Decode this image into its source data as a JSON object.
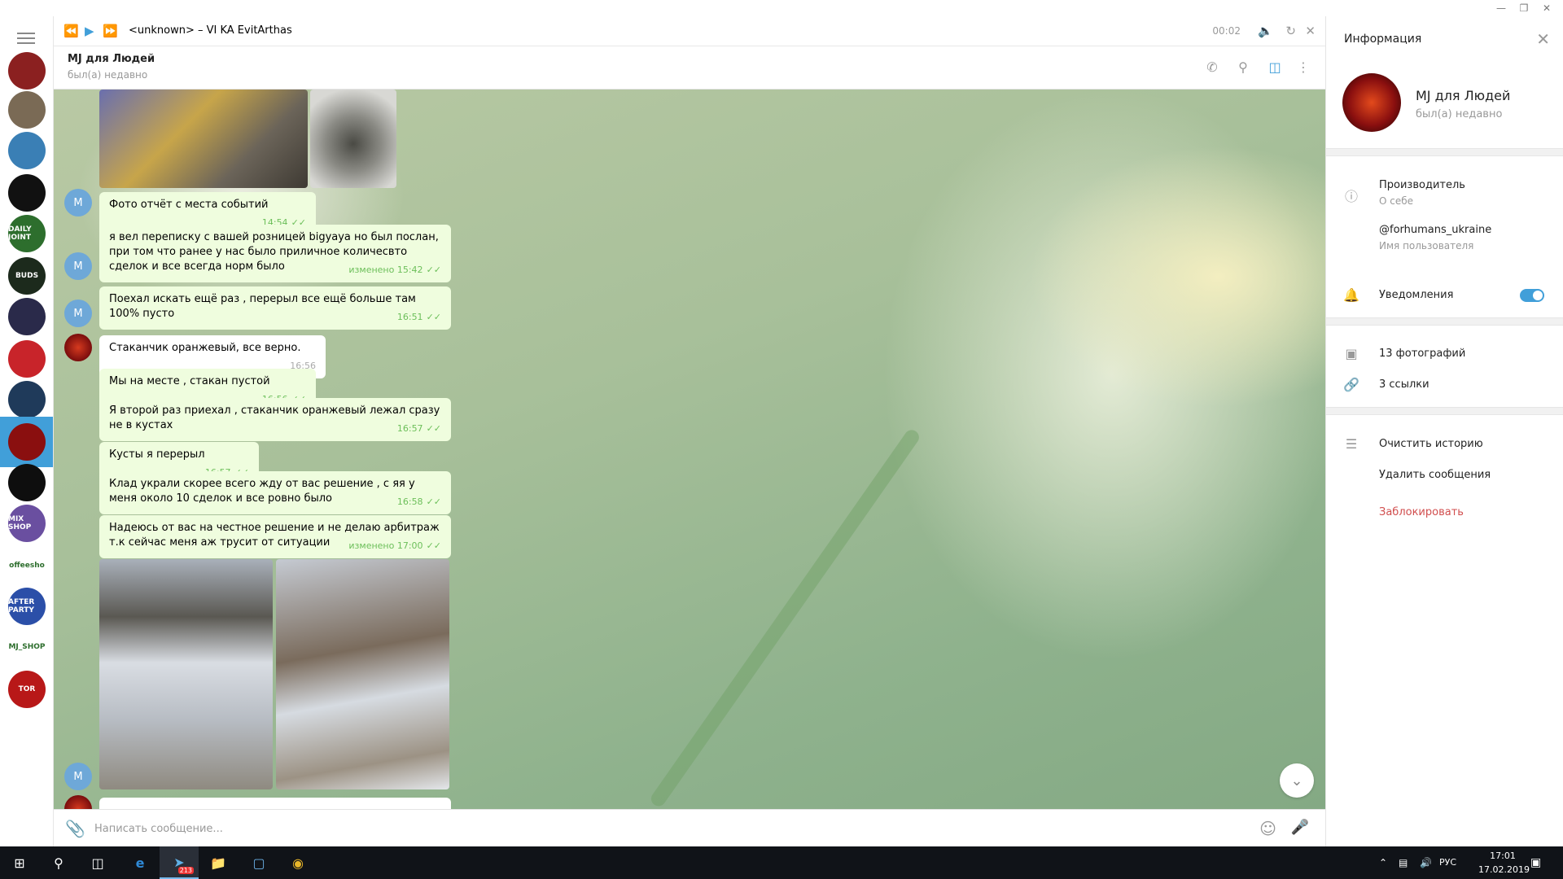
{
  "player": {
    "track": "<unknown> – VI KA  EvitArthas",
    "time": "00:02"
  },
  "chat": {
    "name": "MJ для Людей",
    "status": "был(а) недавно"
  },
  "messages": [
    {
      "text": "Фото отчёт с места событий",
      "time": "14:54"
    },
    {
      "text": "я вел переписку с вашей розницей bigyaya но был послан, при том что ранее у нас было приличное количесвто сделок и все всегда норм было",
      "time": "изменено 15:42"
    },
    {
      "text": "Поехал искать ещё раз , перерыл все ещё больше там 100% пусто",
      "time": "16:51"
    },
    {
      "text": "Стаканчик оранжевый, все верно.",
      "time": "16:56"
    },
    {
      "text": "Мы на месте , стакан пустой",
      "time": "16:56"
    },
    {
      "text": "Я второй раз приехал ,  стаканчик оранжевый лежал сразу не в кустах",
      "time": "16:57"
    },
    {
      "text": "Кусты я перерыл",
      "time": "16:57"
    },
    {
      "text": "Клад украли скорее всего жду от вас решение , с яя у меня около 10 сделок и все ровно было",
      "time": "16:58"
    },
    {
      "text": "Надеюсь от вас на  честное решение и не делаю арбитраж т.к сейчас меня аж трусит от ситуации",
      "time": "изменено 17:00"
    }
  ],
  "user_avatar_letter": "M",
  "compose": {
    "placeholder": "Написать сообщение..."
  },
  "info": {
    "title": "Информация",
    "name": "MJ для Людей",
    "status": "был(а) недавно",
    "about_value": "Производитель",
    "about_label": "О себе",
    "username_value": "@forhumans_ukraine",
    "username_label": "Имя пользователя",
    "notifications": "Уведомления",
    "photos": "13 фотографий",
    "links": "3 ссылки",
    "clear_history": "Очистить историю",
    "delete_messages": "Удалить сообщения",
    "block": "Заблокировать"
  },
  "sidebar": {
    "avatars": [
      {
        "label": "",
        "color": "#8b2020"
      },
      {
        "label": "",
        "color": "#7a6a55"
      },
      {
        "label": "",
        "color": "#3a7fb5"
      },
      {
        "label": "",
        "color": "#111111"
      },
      {
        "label": "DAILY JOINT",
        "color": "#2d6e2d"
      },
      {
        "label": "BUDS",
        "color": "#1c2a1c"
      },
      {
        "label": "",
        "color": "#2a2a4a"
      },
      {
        "label": "",
        "color": "#c8242a"
      },
      {
        "label": "",
        "color": "#1f3a5a"
      },
      {
        "label": "",
        "color": "#8a0f0f"
      },
      {
        "label": "",
        "color": "#0e0e0e"
      },
      {
        "label": "MIX SHOP",
        "color": "#6a4fa0"
      },
      {
        "label": "offeesho",
        "color": "#ffffff"
      },
      {
        "label": "AFTER PARTY",
        "color": "#2b4fa8"
      },
      {
        "label": "MJ_SHOP",
        "color": "#ffffff"
      },
      {
        "label": "TOR",
        "color": "#b81818"
      }
    ]
  },
  "taskbar": {
    "telegram_badge": "213",
    "lang": "РУС",
    "time": "17:01",
    "date": "17.02.2019"
  }
}
